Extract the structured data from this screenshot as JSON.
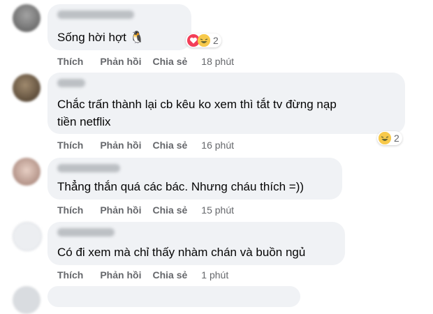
{
  "comments": [
    {
      "text_lines": [
        "Sống hời hợt 🐧"
      ],
      "actions": {
        "like": "Thích",
        "reply": "Phản hồi",
        "share": "Chia sẻ",
        "time": "18 phút"
      },
      "reactions": {
        "types": [
          "love",
          "haha"
        ],
        "count": "2"
      },
      "avatar_color": "#8c8c8c"
    },
    {
      "text_lines": [
        "Chắc trấn thành lại cb kêu ko xem thì tắt tv đừng nạp",
        "tiền netflix"
      ],
      "actions": {
        "like": "Thích",
        "reply": "Phản hồi",
        "share": "Chia sẻ",
        "time": "16 phút"
      },
      "reactions": {
        "types": [
          "haha"
        ],
        "count": "2"
      },
      "avatar_color": "#7a6650"
    },
    {
      "text_lines": [
        "Thẳng thắn quá các bác. Nhưng cháu thích =))"
      ],
      "actions": {
        "like": "Thích",
        "reply": "Phản hồi",
        "share": "Chia sẻ",
        "time": "15 phút"
      },
      "avatar_color": "#c9a89a"
    },
    {
      "text_lines": [
        "Có đi xem mà chỉ thấy nhàm chán và buồn ngủ"
      ],
      "actions": {
        "like": "Thích",
        "reply": "Phản hồi",
        "share": "Chia sẻ",
        "time": "1 phút"
      },
      "avatar_color": "#e4e6e9"
    }
  ],
  "colors": {
    "bubble": "#f0f2f5",
    "action_text": "#65676b",
    "comment_text": "#050505",
    "heart": "#f33e58",
    "haha": "#f7c94b"
  }
}
